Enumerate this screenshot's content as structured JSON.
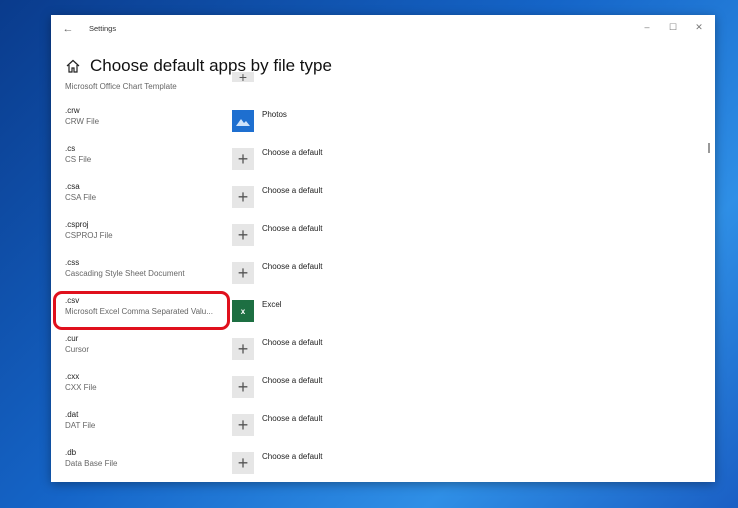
{
  "window": {
    "title": "Settings",
    "back_icon": "back-arrow-icon",
    "controls": {
      "minimize": "–",
      "maximize": "☐",
      "close": "✕"
    }
  },
  "header": {
    "home_icon": "home-icon",
    "title": "Choose default apps by file type"
  },
  "partial_row": {
    "desc": "Microsoft Office Chart Template"
  },
  "rows": [
    {
      "ext": ".crw",
      "desc": "CRW File",
      "app": "Photos",
      "icon": "photos-icon"
    },
    {
      "ext": ".cs",
      "desc": "CS File",
      "app": "Choose a default",
      "icon": "plus-icon"
    },
    {
      "ext": ".csa",
      "desc": "CSA File",
      "app": "Choose a default",
      "icon": "plus-icon"
    },
    {
      "ext": ".csproj",
      "desc": "CSPROJ File",
      "app": "Choose a default",
      "icon": "plus-icon"
    },
    {
      "ext": ".css",
      "desc": "Cascading Style Sheet Document",
      "app": "Choose a default",
      "icon": "plus-icon"
    },
    {
      "ext": ".csv",
      "desc": "Microsoft Excel Comma Separated Valu...",
      "app": "Excel",
      "icon": "excel-icon"
    },
    {
      "ext": ".cur",
      "desc": "Cursor",
      "app": "Choose a default",
      "icon": "plus-icon"
    },
    {
      "ext": ".cxx",
      "desc": "CXX File",
      "app": "Choose a default",
      "icon": "plus-icon"
    },
    {
      "ext": ".dat",
      "desc": "DAT File",
      "app": "Choose a default",
      "icon": "plus-icon"
    },
    {
      "ext": ".db",
      "desc": "Data Base File",
      "app": "Choose a default",
      "icon": "plus-icon"
    }
  ],
  "icons": {
    "plus": "+",
    "excel": "x"
  },
  "colors": {
    "highlight": "#e0101d",
    "photos": "#1e6fd0",
    "excel": "#1d6f42"
  }
}
